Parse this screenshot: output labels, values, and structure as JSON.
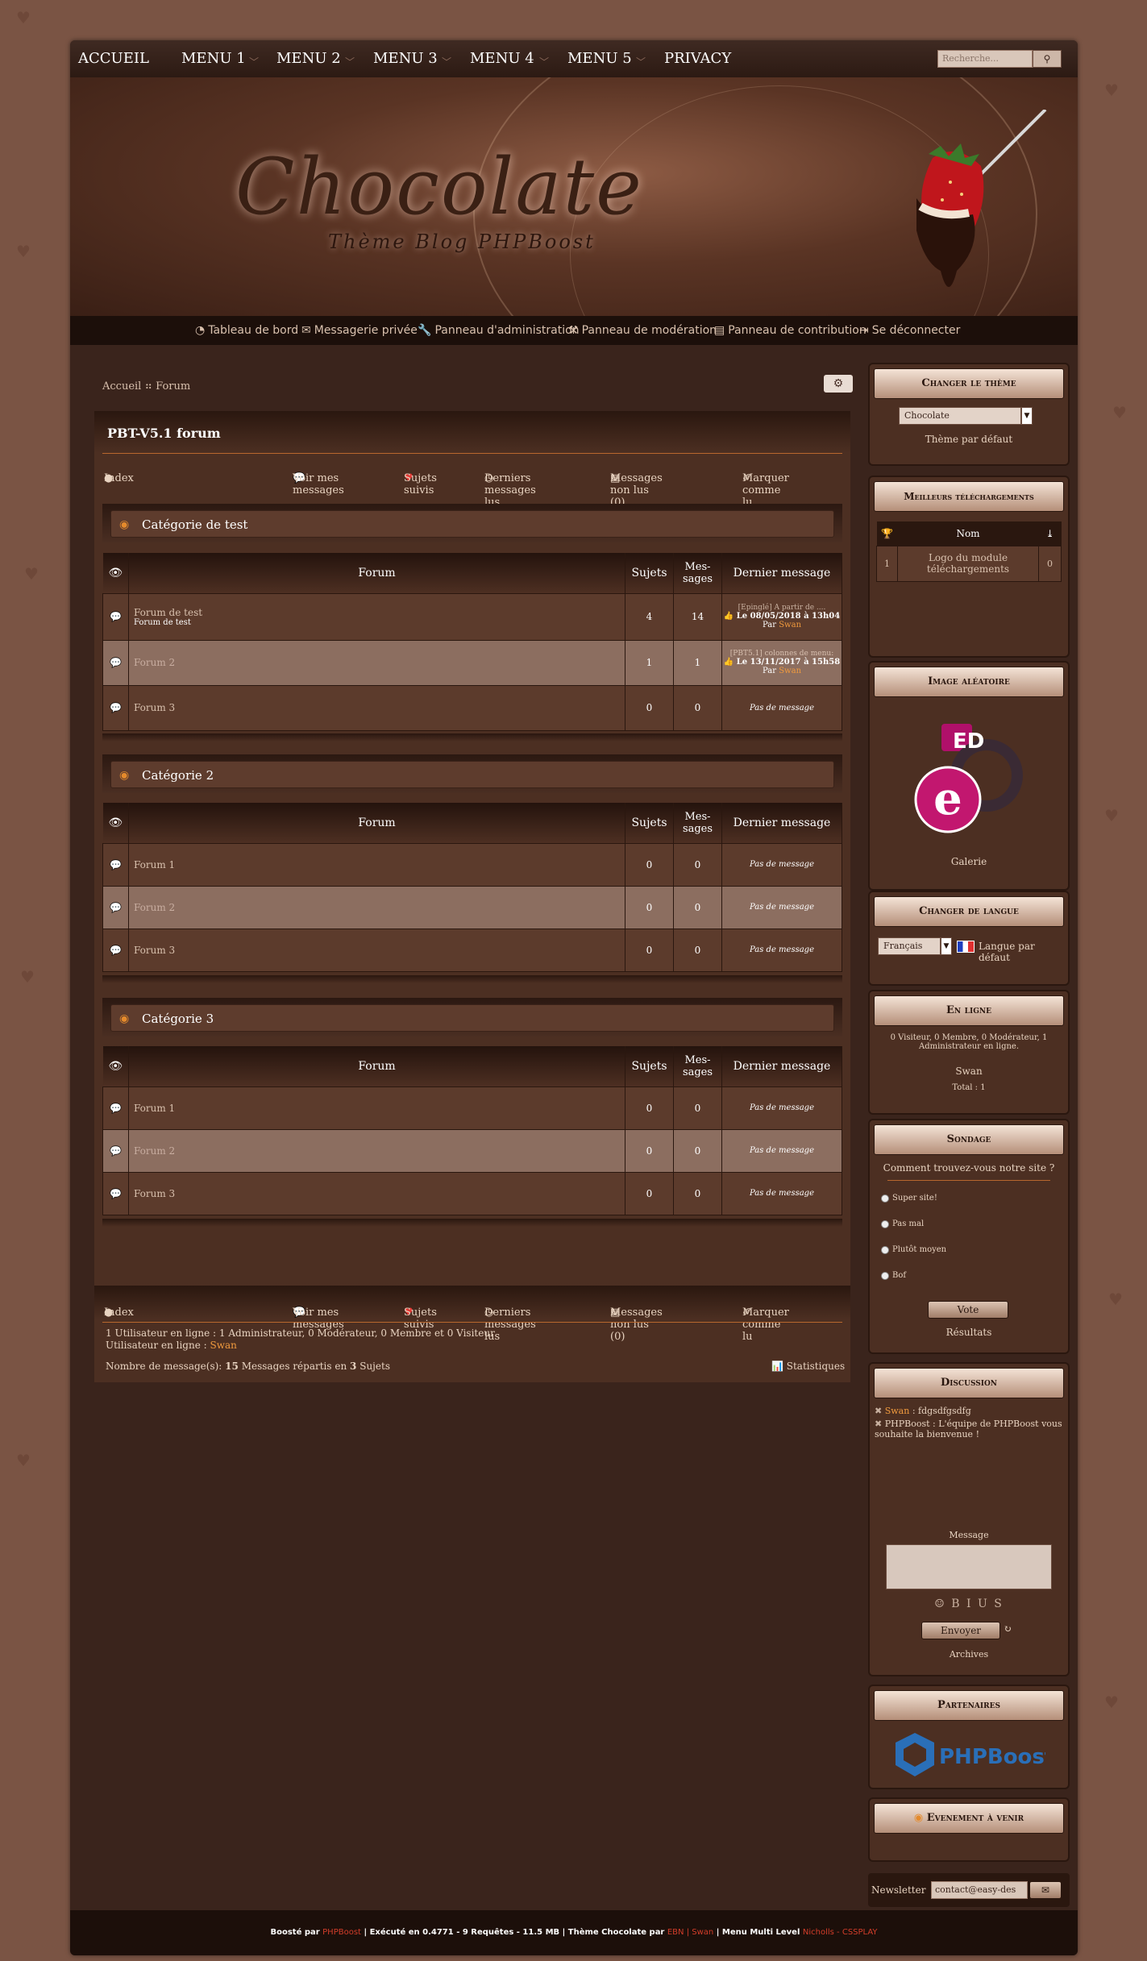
{
  "top_menu": {
    "items": [
      "ACCUEIL",
      "MENU 1",
      "MENU 2",
      "MENU 3",
      "MENU 4",
      "MENU 5",
      "PRIVACY"
    ],
    "search_placeholder": "Recherche...",
    "search_icon": "search-icon"
  },
  "banner": {
    "title": "Chocolate",
    "subtitle": "Thème Blog PHPBoost"
  },
  "user_bar": {
    "links": [
      "Tableau de bord",
      "Messagerie privée",
      "Panneau d'administration",
      "Panneau de modération",
      "Panneau de contribution",
      "Se déconnecter"
    ]
  },
  "breadcrumb": [
    "Accueil",
    "Forum"
  ],
  "forum": {
    "title": "PBT-V5.1 forum",
    "nav": {
      "index": "Index",
      "links": [
        "Voir mes messages",
        "Sujets suivis",
        "Derniers messages lus",
        "Messages non lus (0)",
        "Marquer comme lu"
      ]
    },
    "columns": [
      "Forum",
      "Sujets",
      "Mes-sages",
      "Dernier message"
    ],
    "categories": [
      {
        "name": "Catégorie de test",
        "rows": [
          {
            "name": "Forum de test",
            "sub": "Forum de test",
            "topics": "4",
            "messages": "14",
            "last_line1": "[Epinglé] A partir de ....",
            "last_line2": "Le 08/05/2018 à 13h04",
            "last_by": "Par",
            "last_user": "Swan"
          },
          {
            "name": "Forum 2",
            "sub": "",
            "topics": "1",
            "messages": "1",
            "last_line1": "[PBT5.1] colonnes de menu:",
            "last_line2": "Le 13/11/2017 à 15h58",
            "last_by": "Par",
            "last_user": "Swan"
          },
          {
            "name": "Forum 3",
            "sub": "",
            "topics": "0",
            "messages": "0",
            "last_line1": "Pas de message",
            "last_line2": "",
            "last_by": "",
            "last_user": ""
          }
        ]
      },
      {
        "name": "Catégorie 2",
        "rows": [
          {
            "name": "Forum 1",
            "topics": "0",
            "messages": "0",
            "last_line1": "Pas de message"
          },
          {
            "name": "Forum 2",
            "topics": "0",
            "messages": "0",
            "last_line1": "Pas de message"
          },
          {
            "name": "Forum 3",
            "topics": "0",
            "messages": "0",
            "last_line1": "Pas de message"
          }
        ]
      },
      {
        "name": "Catégorie 3",
        "rows": [
          {
            "name": "Forum 1",
            "topics": "0",
            "messages": "0",
            "last_line1": "Pas de message"
          },
          {
            "name": "Forum 2",
            "topics": "0",
            "messages": "0",
            "last_line1": "Pas de message"
          },
          {
            "name": "Forum 3",
            "topics": "0",
            "messages": "0",
            "last_line1": "Pas de message"
          }
        ]
      }
    ],
    "footer": {
      "online_line": "1 Utilisateur en ligne : 1 Administrateur, 0 Modérateur, 0 Membre et 0 Visiteur",
      "online_users_label": "Utilisateur en ligne :",
      "online_user": "Swan",
      "stats_prefix": "Nombre de message(s):",
      "stats_count": "15",
      "stats_rest": "Messages répartis en",
      "stats_topics": "3",
      "stats_topics_label": "Sujets",
      "stats_link": "Statistiques"
    }
  },
  "sidebar": {
    "theme": {
      "title": "Changer le thème",
      "selected": "Chocolate",
      "default": "Thème par défaut"
    },
    "downloads": {
      "title": "Meilleurs téléchargements",
      "col_name": "Nom",
      "rank": "1",
      "item": "Logo du module téléchargements",
      "count": "0"
    },
    "random_image": {
      "title": "Image aléatoire",
      "caption": "Galerie",
      "logo_text": "ED"
    },
    "language": {
      "title": "Changer de langue",
      "selected": "Français",
      "default": "Langue par défaut"
    },
    "online": {
      "title": "En ligne",
      "summary": "0 Visiteur, 0 Membre, 0 Modérateur, 1 Administrateur en ligne.",
      "user": "Swan",
      "total": "Total : 1"
    },
    "poll": {
      "title": "Sondage",
      "question": "Comment trouvez-vous notre site ?",
      "options": [
        "Super site!",
        "Pas mal",
        "Plutôt moyen",
        "Bof"
      ],
      "vote": "Vote",
      "results": "Résultats"
    },
    "discussion": {
      "title": "Discussion",
      "msg1_user": "Swan",
      "msg1_text": ": fdgsdfgsdfg",
      "msg2_text": "PHPBoost : L'équipe de PHPBoost vous souhaite la bienvenue !",
      "message_label": "Message",
      "format": "☺ B I U S",
      "send": "Envoyer",
      "archives": "Archives"
    },
    "partners": {
      "title": "Partenaires",
      "logo": "PHPBoost"
    },
    "events": {
      "title": "Evenement à venir"
    },
    "newsletter": {
      "label": "Newsletter",
      "placeholder": "contact@easy-des"
    }
  },
  "page_footer": {
    "boosted": "Boosté par",
    "phpboost": "PHPBoost",
    "executed": "| Exécuté en 0.4771 - 9 Requêtes - 11.5 MB | Thème Chocolate par",
    "authors": "EBN | Swan",
    "menu": "| Menu Multi Level",
    "credit": "Nicholls - CSSPLAY"
  },
  "colors": {
    "accent": "#f09a3e",
    "background": "#7a5444",
    "panel": "#4c2f22",
    "dark": "#2a170f"
  }
}
